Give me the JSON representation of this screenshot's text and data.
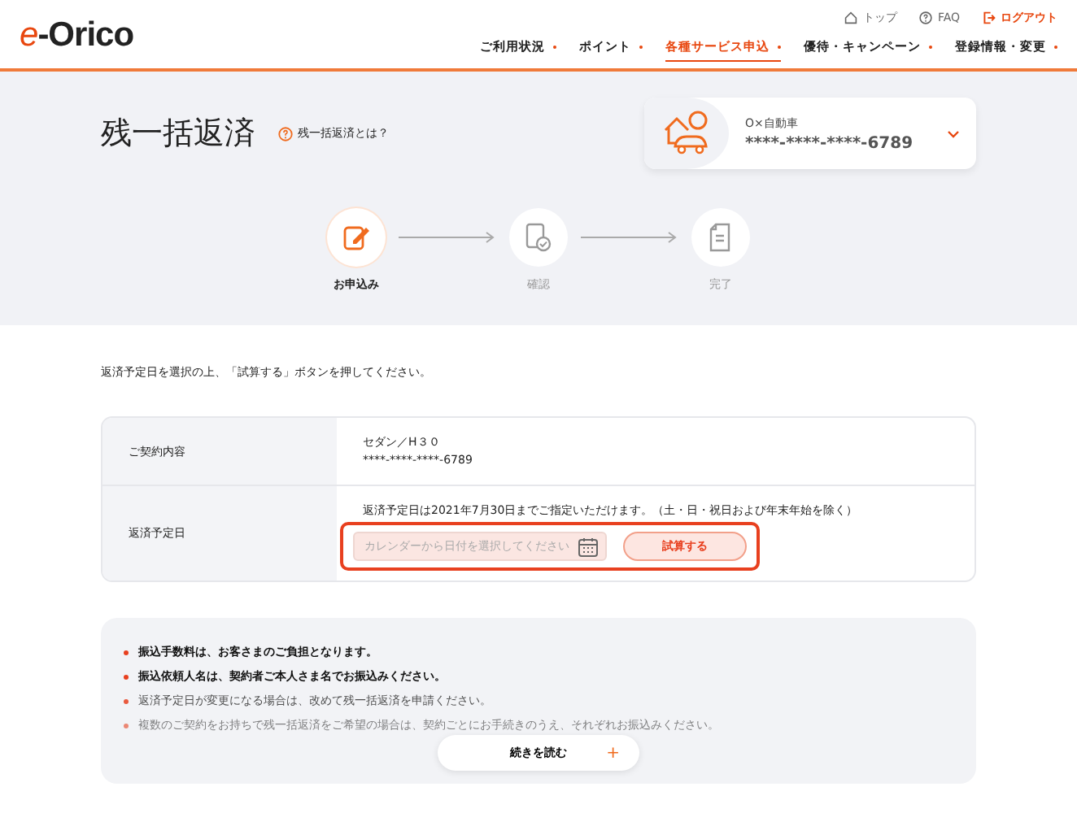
{
  "logo": {
    "prefix": "e",
    "rest": "-Orico"
  },
  "top_links": [
    {
      "label": "トップ",
      "kind": "home"
    },
    {
      "label": "FAQ",
      "kind": "help"
    },
    {
      "label": "ログアウト",
      "kind": "logout"
    }
  ],
  "nav": [
    {
      "label": "ご利用状況",
      "selected": false
    },
    {
      "label": "ポイント",
      "selected": false
    },
    {
      "label": "各種サービス申込",
      "selected": true
    },
    {
      "label": "優待・キャンペーン",
      "selected": false
    },
    {
      "label": "登録情報・変更",
      "selected": false
    }
  ],
  "page_title": "残一括返済",
  "help_link": "残一括返済とは？",
  "contract_card": {
    "name": "O×自動車",
    "number": "****-****-****-6789"
  },
  "steps": [
    {
      "label": "お申込み",
      "selected": true,
      "kind": "apply"
    },
    {
      "label": "確認",
      "selected": false,
      "kind": "confirm"
    },
    {
      "label": "完了",
      "selected": false,
      "kind": "done"
    }
  ],
  "instruction": "返済予定日を選択の上、「試算する」ボタンを押してください。",
  "table": {
    "rows": [
      {
        "label": "ご契約内容",
        "kind": "text",
        "lines": [
          "セダン／H３０",
          "****-****-****-6789"
        ]
      },
      {
        "label": "返済予定日",
        "kind": "date",
        "note": "返済予定日は2021年7月30日までご指定いただけます。（土・日・祝日および年末年始を除く）",
        "placeholder": "カレンダーから日付を選択してください",
        "button": "試算する"
      }
    ]
  },
  "notes": [
    "振込手数料は、お客さまのご負担となります。",
    "振込依頼人名は、契約者ご本人さま名でお振込みください。",
    "返済予定日が変更になる場合は、改めて残一括返済を申請ください。",
    "複数のご契約をお持ちで残一括返済をご希望の場合は、契約ごとにお手続きのうえ、それぞれお振込みください。"
  ],
  "read_more": {
    "label": "続きを読む",
    "icon": "+"
  }
}
